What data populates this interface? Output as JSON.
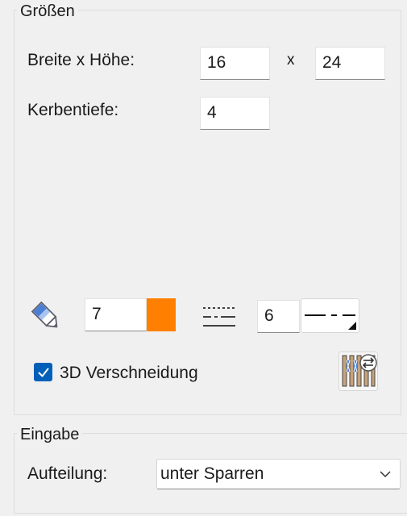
{
  "groups": {
    "sizes": {
      "title": "Größen",
      "width_height_label": "Breite x Höhe:",
      "width_value": "16",
      "times_symbol": "x",
      "height_value": "24",
      "notch_depth_label": "Kerbentiefe:",
      "notch_depth_value": "4"
    },
    "attributes": {
      "pen_value": "7",
      "pen_color": "#ff8000",
      "line_type_value": "6",
      "three_d_label": "3D Verschneidung",
      "three_d_checked": true
    },
    "input": {
      "title": "Eingabe",
      "division_label": "Aufteilung:",
      "division_selected": "unter Sparren"
    }
  },
  "icons": {
    "pen": "pencil-icon",
    "line_type": "line-type-icon",
    "line_style": "dash-dot-line-icon",
    "check": "checkmark-icon",
    "rafter_settings": "rafter-settings-icon",
    "chevron": "chevron-down-icon"
  }
}
